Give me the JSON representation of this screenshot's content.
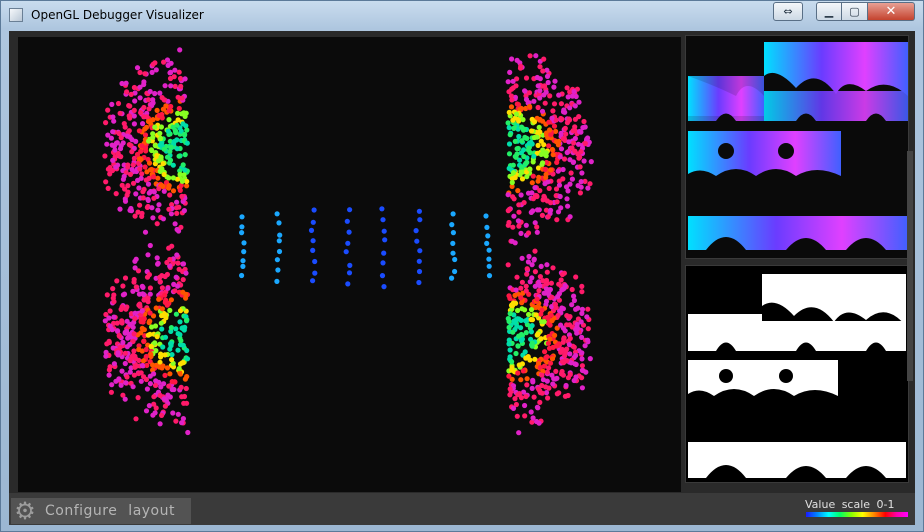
{
  "window": {
    "title": "OpenGL Debugger Visualizer",
    "buttons": {
      "swap_icon": "swap-arrows-icon",
      "minimize_icon": "minimize-icon",
      "maximize_icon": "maximize-icon",
      "close_icon": "close-icon"
    }
  },
  "bottombar": {
    "configure_label": "Configure layout",
    "gear_icon": "gear-icon",
    "scale_label": "Value scale 0-1"
  },
  "colors": {
    "background": "#0b0b0b",
    "panel": "#2a2a2a",
    "scale_start": "#1a1aff",
    "scale_end": "#ff00ff"
  }
}
